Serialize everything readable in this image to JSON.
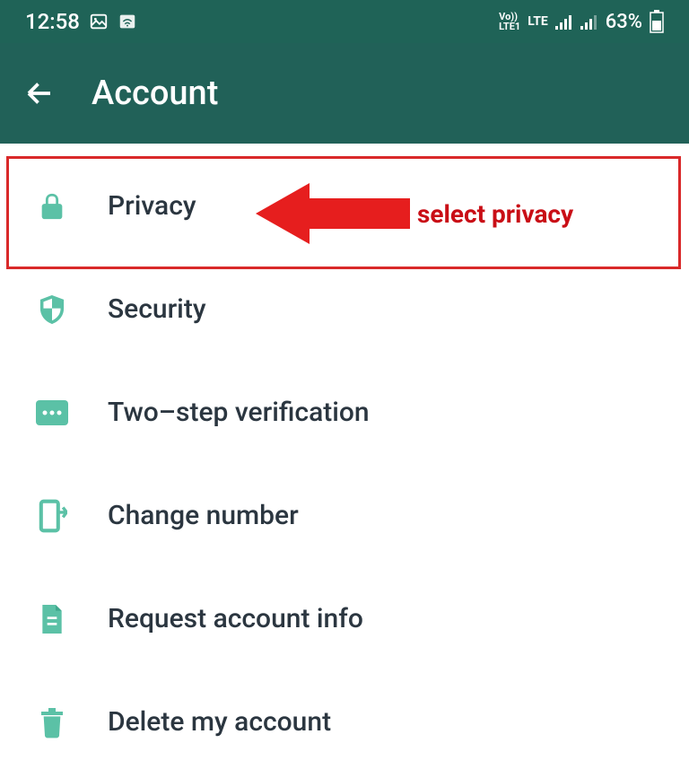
{
  "status_bar": {
    "time": "12:58",
    "volte_label": "Vo))",
    "lte1_label": "LTE1",
    "lte_label": "LTE",
    "battery_percent": "63%"
  },
  "header": {
    "title": "Account"
  },
  "items": [
    {
      "label": "Privacy",
      "icon": "lock-icon"
    },
    {
      "label": "Security",
      "icon": "shield-icon"
    },
    {
      "label": "Two–step verification",
      "icon": "dots-icon"
    },
    {
      "label": "Change number",
      "icon": "change-icon"
    },
    {
      "label": "Request account info",
      "icon": "document-icon"
    },
    {
      "label": "Delete my account",
      "icon": "trash-icon"
    }
  ],
  "annotation": {
    "text": "select privacy"
  },
  "colors": {
    "header_bg": "#216158",
    "icon_color": "#5bc1a6",
    "text_color": "#2b3640",
    "highlight": "#d9292a"
  }
}
